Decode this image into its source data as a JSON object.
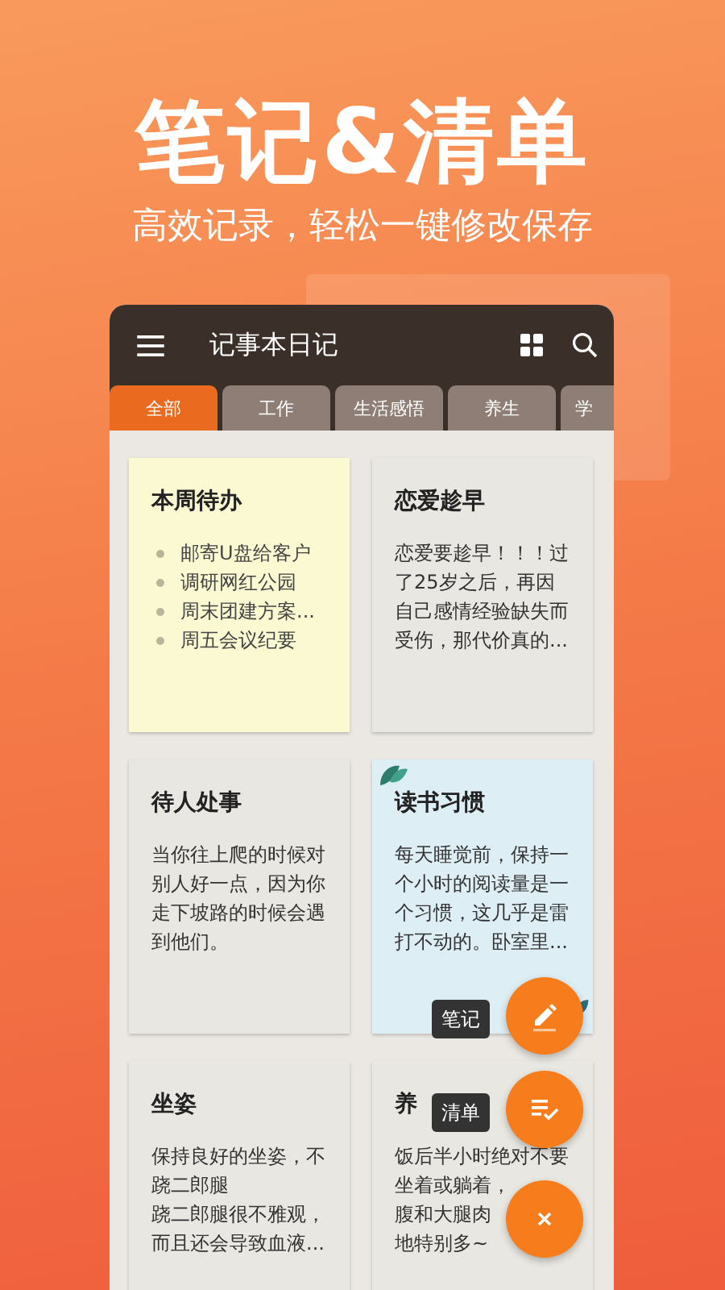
{
  "headline": "笔记&清单",
  "subtitle": "高效记录，轻松一键修改保存",
  "app": {
    "title": "记事本日记",
    "tabs": [
      {
        "label": "全部",
        "selected": true
      },
      {
        "label": "工作",
        "selected": false
      },
      {
        "label": "生活感悟",
        "selected": false
      },
      {
        "label": "养生",
        "selected": false
      },
      {
        "label": "学",
        "selected": false
      }
    ],
    "notes": [
      {
        "kind": "checklist",
        "title": "本周待办",
        "color": "#fbf9d2",
        "leaves": false,
        "items": [
          "邮寄U盘给客户",
          "调研网红公园",
          "周末团建方案...",
          "周五会议纪要"
        ]
      },
      {
        "kind": "text",
        "title": "恋爱趁早",
        "color": "#e9e7e2",
        "leaves": false,
        "lines": [
          "恋爱要趁早！！！过",
          "了25岁之后，再因",
          "自己感情经验缺失而",
          "受伤，那代价真的..."
        ]
      },
      {
        "kind": "text",
        "title": "待人处事",
        "color": "#e9e7e2",
        "leaves": false,
        "lines": [
          "当你往上爬的时候对",
          "别人好一点，因为你",
          "走下坡路的时候会遇",
          "到他们。"
        ]
      },
      {
        "kind": "text",
        "title": "读书习惯",
        "color": "#deeef5",
        "leaves": true,
        "lines": [
          "每天睡觉前，保持一",
          "个小时的阅读量是一",
          "个习惯，这几乎是雷",
          "打不动的。卧室里..."
        ]
      },
      {
        "kind": "text",
        "title": "坐姿",
        "color": "#e9e7e2",
        "leaves": false,
        "lines": [
          "保持良好的坐姿，不",
          "跷二郎腿",
          "跷二郎腿很不雅观，",
          "而且还会导致血液..."
        ]
      },
      {
        "kind": "text",
        "title": "养",
        "color": "#e9e7e2",
        "leaves": false,
        "lines": [
          "饭后半小时绝对不要",
          "坐着或躺着，",
          "腹和大腿肉",
          "地特别多~"
        ]
      }
    ],
    "fab_menu": [
      {
        "kind": "note",
        "label": "笔记"
      },
      {
        "kind": "checklist",
        "label": "清单"
      },
      {
        "kind": "close"
      }
    ]
  }
}
